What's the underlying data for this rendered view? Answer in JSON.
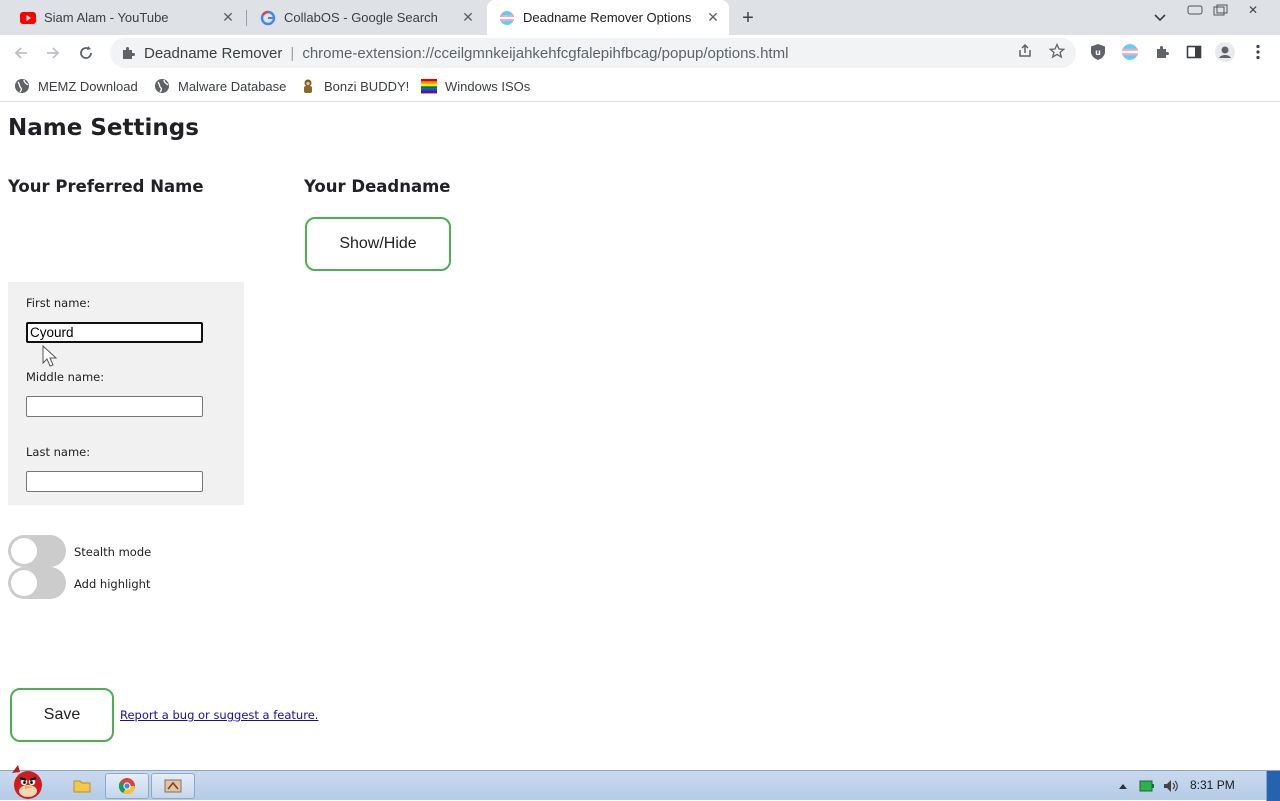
{
  "browser": {
    "tabs": [
      {
        "title": "Siam Alam - YouTube",
        "icon": "youtube-icon",
        "active": false
      },
      {
        "title": "CollabOS - Google Search",
        "icon": "google-icon",
        "active": false
      },
      {
        "title": "Deadname Remover Options",
        "icon": "trans-flag-icon",
        "active": true
      }
    ],
    "omnibox": {
      "extension_name": "Deadname Remover",
      "separator": "|",
      "url": "chrome-extension://cceilgmnkeijahkehfcgfalepihfbcag/popup/options.html"
    },
    "bookmarks": [
      {
        "label": "MEMZ Download",
        "icon": "globe-icon"
      },
      {
        "label": "Malware Database",
        "icon": "globe-icon"
      },
      {
        "label": "Bonzi BUDDY!",
        "icon": "bonzi-icon"
      },
      {
        "label": "Windows ISOs",
        "icon": "rainbow-flag-icon"
      }
    ]
  },
  "page": {
    "title": "Name Settings",
    "preferred_heading": "Your Preferred Name",
    "deadname_heading": "Your Deadname",
    "show_hide_label": "Show/Hide",
    "form": {
      "first_label": "First name:",
      "first_value": "Cyourd",
      "middle_label": "Middle name:",
      "middle_value": "",
      "last_label": "Last name:",
      "last_value": ""
    },
    "toggles": [
      {
        "label": "Stealth mode",
        "on": false
      },
      {
        "label": "Add highlight",
        "on": false
      }
    ],
    "save_label": "Save",
    "report_link": "Report a bug or suggest a feature.",
    "accent_color": "#4caf50"
  },
  "taskbar": {
    "clock": "8:31 PM"
  }
}
